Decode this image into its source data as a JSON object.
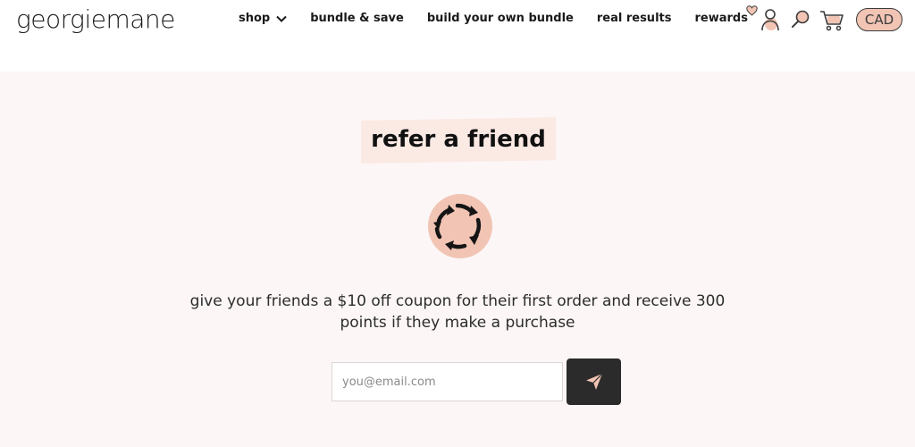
{
  "brand": {
    "logo": "georgiemane"
  },
  "nav": {
    "items": [
      {
        "label": "shop",
        "has_dropdown": true
      },
      {
        "label": "bundle & save"
      },
      {
        "label": "build your own bundle"
      },
      {
        "label": "real results"
      },
      {
        "label": "rewards",
        "badge_icon": "heart-icon"
      }
    ]
  },
  "header_icons": [
    "account-icon",
    "search-icon",
    "cart-icon"
  ],
  "currency": "CAD",
  "refer": {
    "title": "refer a friend",
    "icon": "refresh-arrows-icon",
    "description": "give your friends a $10 off coupon for their first order and receive 300 points if they make a purchase",
    "email_placeholder": "you@email.com",
    "email_value": "",
    "send_icon": "paper-plane-icon"
  },
  "colors": {
    "accent_peach": "#f1c4b4",
    "page_bg": "#fcf6f6",
    "button_dark": "#2b2b2b"
  }
}
